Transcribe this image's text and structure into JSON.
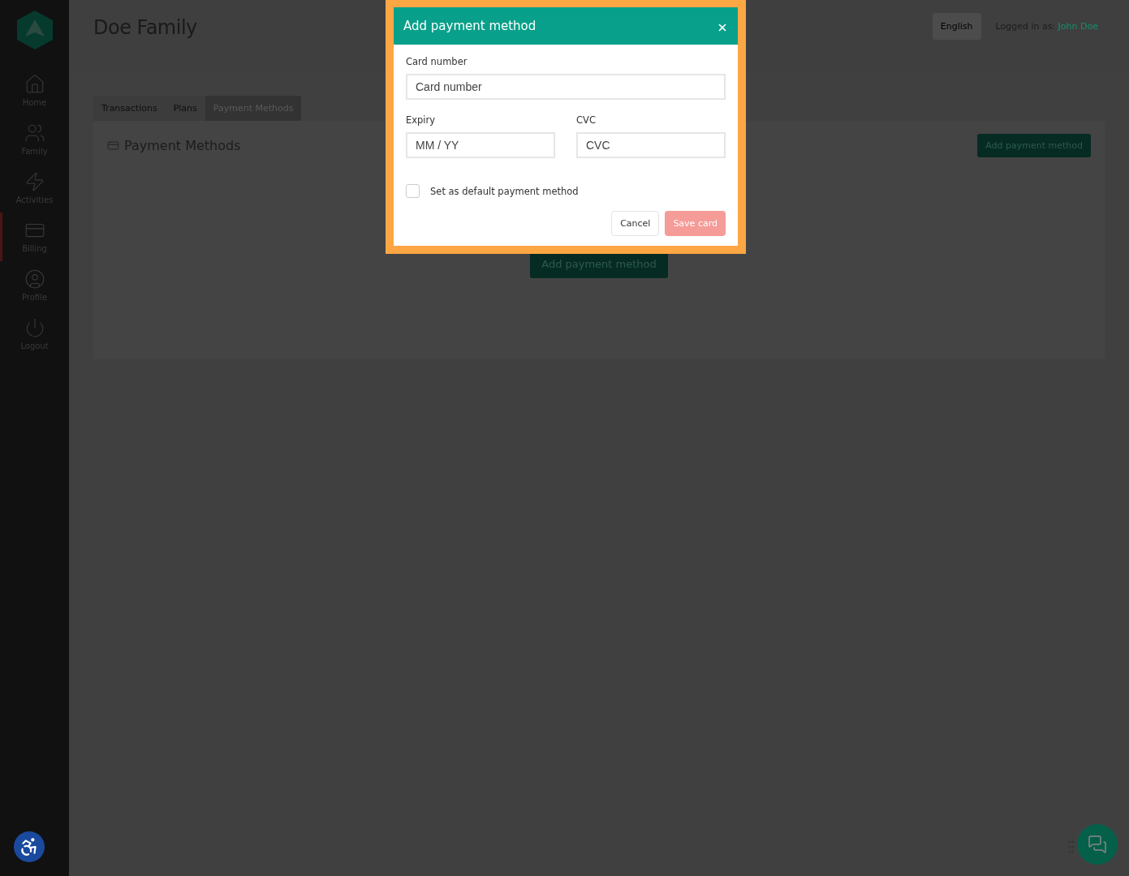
{
  "sidebar": {
    "items": [
      {
        "label": "Home",
        "selected": false
      },
      {
        "label": "Family",
        "selected": false
      },
      {
        "label": "Activities",
        "selected": false
      },
      {
        "label": "Billing",
        "selected": true
      },
      {
        "label": "Profile",
        "selected": false
      },
      {
        "label": "Logout",
        "selected": false
      }
    ]
  },
  "header": {
    "title": "Doe Family",
    "language": "English",
    "logged_in_label": "Logged in as:",
    "user_name": "John Doe"
  },
  "tabs": [
    {
      "label": "Transactions",
      "selected": false
    },
    {
      "label": "Plans",
      "selected": false
    },
    {
      "label": "Payment Methods",
      "selected": true
    }
  ],
  "panel": {
    "title": "Payment Methods",
    "add_button": "Add payment method",
    "empty_button": "Add payment method"
  },
  "modal": {
    "title": "Add payment method",
    "card_label": "Card number",
    "card_placeholder": "Card number",
    "expiry_label": "Expiry",
    "expiry_placeholder": "MM / YY",
    "cvc_label": "CVC",
    "cvc_placeholder": "CVC",
    "default_label": "Set as default payment method",
    "default_checked": false,
    "cancel": "Cancel",
    "save": "Save card",
    "save_disabled": true
  }
}
